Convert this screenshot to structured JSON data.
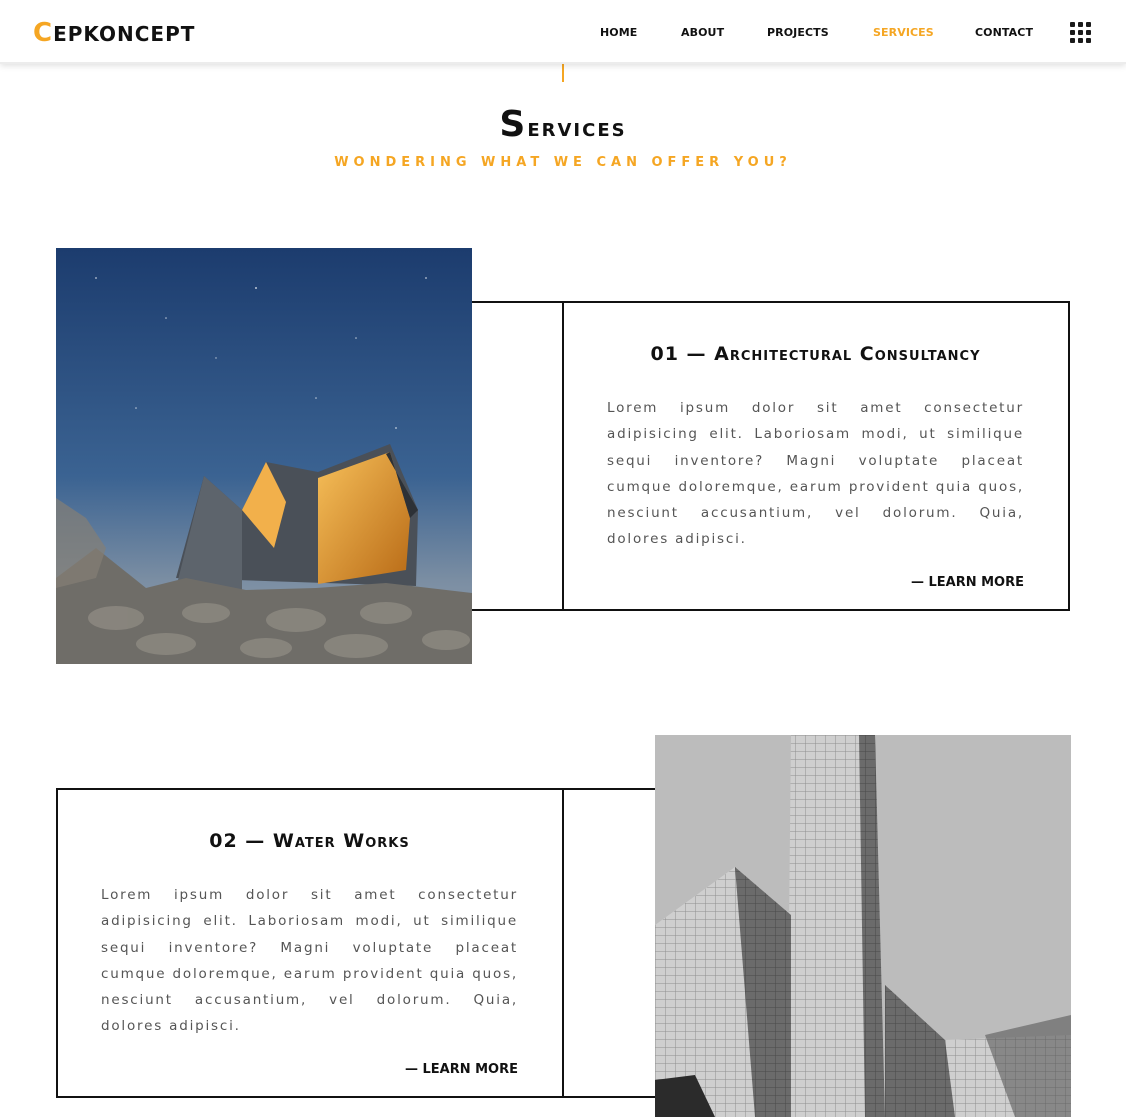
{
  "header": {
    "logo_first": "C",
    "logo_rest": "EPKONCEPT",
    "nav": [
      {
        "label": "HOME"
      },
      {
        "label": "ABOUT"
      },
      {
        "label": "PROJECTS"
      },
      {
        "label": "SERVICES",
        "active": true
      },
      {
        "label": "CONTACT"
      }
    ],
    "menu_icon": "grid-menu-icon"
  },
  "section": {
    "title_first": "S",
    "title_rest": "ervices",
    "subtitle": "WONDERING WHAT WE CAN OFFER YOU?"
  },
  "services": [
    {
      "title": "01 — Architectural Consultancy",
      "description": "Lorem ipsum dolor sit amet consectetur adipisicing elit. Laboriosam modi, ut similique sequi inventore? Magni voluptate placeat cumque doloremque, earum provident quia quos, nesciunt accusantium, vel dolorum. Quia, dolores adipisci.",
      "link": "— LEARN MORE",
      "image": "night-cabin-photo"
    },
    {
      "title": "02 — Water Works",
      "description": "Lorem ipsum dolor sit amet consectetur adipisicing elit. Laboriosam modi, ut similique sequi inventore? Magni voluptate placeat cumque doloremque, earum provident quia quos, nesciunt accusantium, vel dolorum. Quia, dolores adipisci.",
      "link": "— LEARN MORE",
      "image": "grayscale-building-photo"
    }
  ],
  "colors": {
    "accent": "#f5a623",
    "text": "#111111",
    "body_text": "#555555"
  }
}
